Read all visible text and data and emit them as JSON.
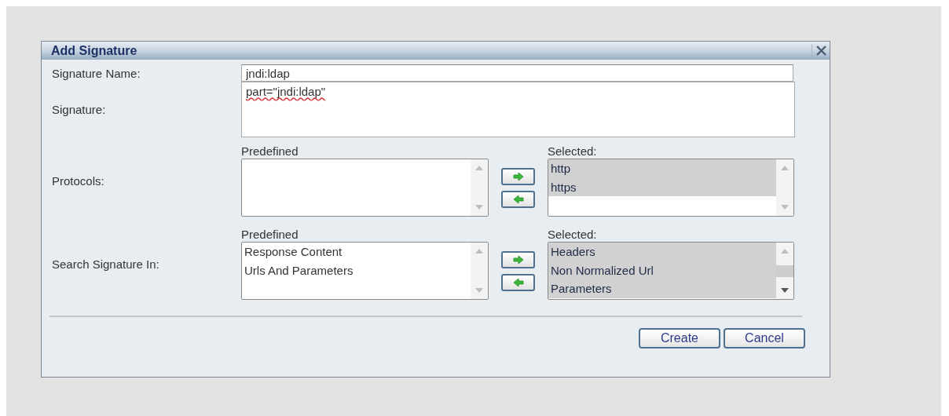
{
  "dialog": {
    "title": "Add Signature",
    "fields": [
      {
        "kind": "input",
        "label": "Signature Name:",
        "value": "jndi:ldap"
      },
      {
        "kind": "textarea",
        "label": "Signature:",
        "value": "part=\"jndi:ldap\""
      }
    ],
    "pickers": [
      {
        "label": "Protocols:",
        "available_caption": "Predefined",
        "selected_caption": "Selected:",
        "chosen": [
          {
            "label": "http",
            "selected": true
          },
          {
            "label": "https",
            "selected": true
          }
        ]
      },
      {
        "label": "Search Signature In:",
        "available_caption": "Predefined",
        "available": [
          {
            "label": "Response Content",
            "selected": false
          },
          {
            "label": "Urls And Parameters",
            "selected": false
          }
        ],
        "selected_caption": "Selected:",
        "chosen": [
          {
            "label": "Headers",
            "selected": true
          },
          {
            "label": "Non Normalized Url",
            "selected": true
          },
          {
            "label": "Parameters",
            "selected": true
          }
        ]
      }
    ],
    "buttons": [
      "Create",
      "Cancel"
    ]
  }
}
